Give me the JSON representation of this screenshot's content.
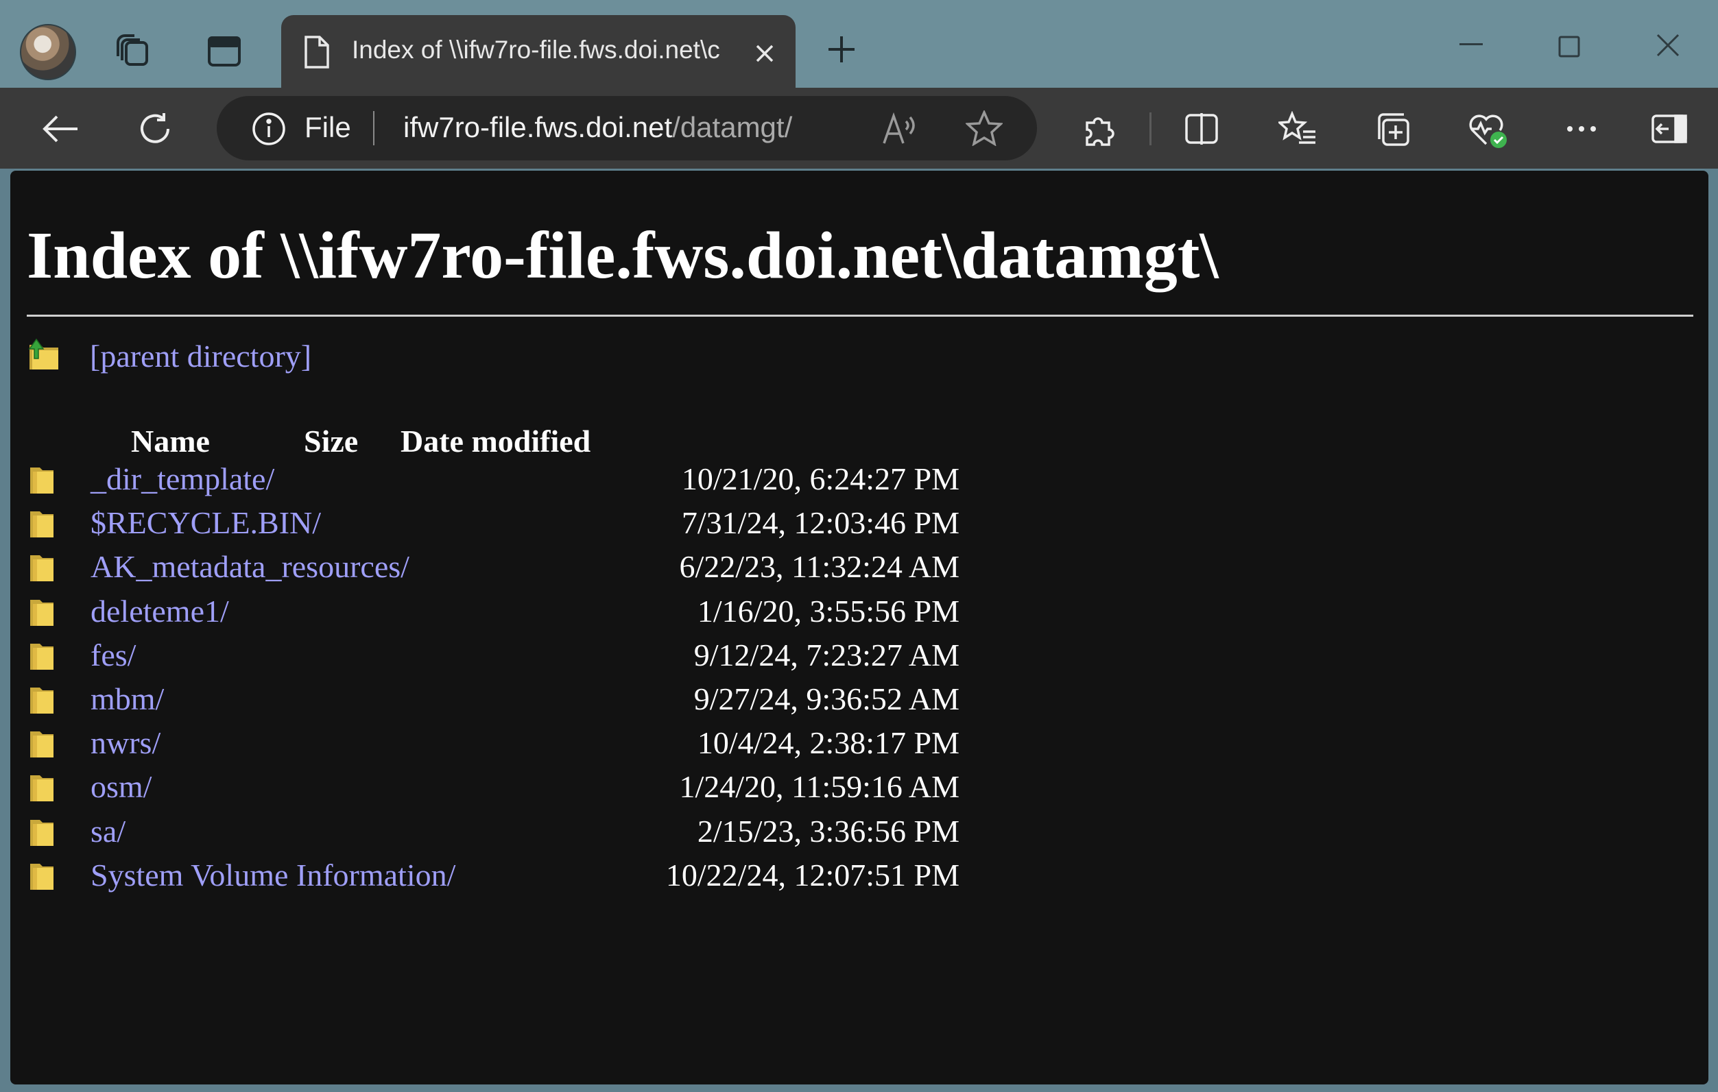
{
  "browser": {
    "tab_title": "Index of \\\\ifw7ro-file.fws.doi.net\\c",
    "address_scheme_label": "File",
    "url_host": "ifw7ro-file.fws.doi.net",
    "url_path": "/datamgt/"
  },
  "page": {
    "heading": "Index of \\\\ifw7ro-file.fws.doi.net\\datamgt\\",
    "parent_link": "[parent directory]",
    "columns": {
      "name": "Name",
      "size": "Size",
      "date": "Date modified"
    },
    "entries": [
      {
        "name": "_dir_template/",
        "size": "",
        "date": "10/21/20, 6:24:27 PM"
      },
      {
        "name": "$RECYCLE.BIN/",
        "size": "",
        "date": "7/31/24, 12:03:46 PM"
      },
      {
        "name": "AK_metadata_resources/",
        "size": "",
        "date": "6/22/23, 11:32:24 AM"
      },
      {
        "name": "deleteme1/",
        "size": "",
        "date": "1/16/20, 3:55:56 PM"
      },
      {
        "name": "fes/",
        "size": "",
        "date": "9/12/24, 7:23:27 AM"
      },
      {
        "name": "mbm/",
        "size": "",
        "date": "9/27/24, 9:36:52 AM"
      },
      {
        "name": "nwrs/",
        "size": "",
        "date": "10/4/24, 2:38:17 PM"
      },
      {
        "name": "osm/",
        "size": "",
        "date": "1/24/20, 11:59:16 AM"
      },
      {
        "name": "sa/",
        "size": "",
        "date": "2/15/23, 3:36:56 PM"
      },
      {
        "name": "System Volume Information/",
        "size": "",
        "date": "10/22/24, 12:07:51 PM"
      }
    ]
  },
  "icons": {
    "folder": "folder-icon",
    "parent": "folder-up-icon"
  },
  "colors": {
    "link": "#9f9ff8",
    "page_bg": "#121212",
    "folder_yellow": "#f2d257"
  }
}
